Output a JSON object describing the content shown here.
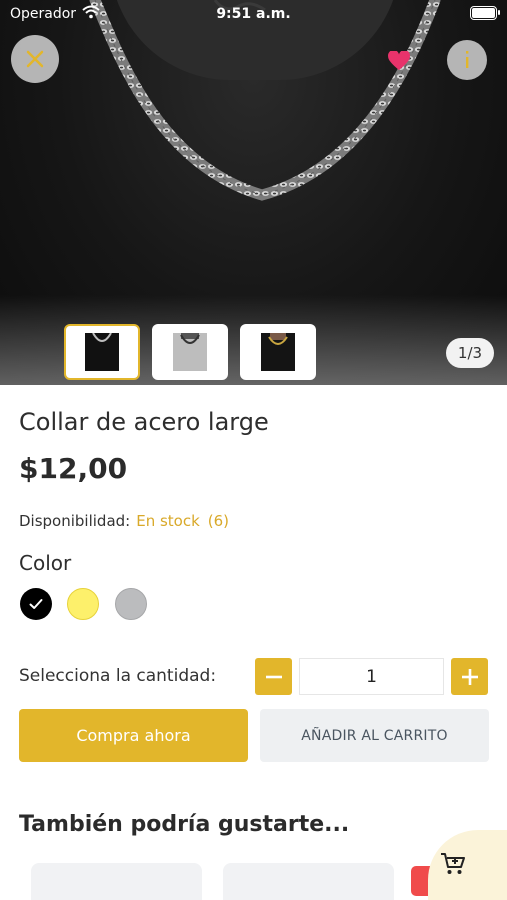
{
  "status_bar": {
    "carrier": "Operador",
    "time": "9:51 a.m."
  },
  "icons": {
    "close": "close-icon",
    "favorite": "heart-icon",
    "info": "info-icon",
    "cart": "cart-add-icon",
    "check": "check-icon"
  },
  "gallery": {
    "pager": "1/3",
    "thumbnails": [
      "black-tshirt-chain",
      "gray-tshirt-chain",
      "black-tshirt-gold-chain"
    ],
    "active_index": 0
  },
  "product": {
    "title": "Collar de acero large",
    "price": "$12,00",
    "availability_label": "Disponibilidad:",
    "availability_status": "En stock",
    "availability_count": "(6)",
    "color_label": "Color",
    "colors": [
      "#000000",
      "#fdf06b",
      "#bbbcbe"
    ],
    "selected_color": "#000000",
    "quantity_label": "Selecciona la cantidad:",
    "quantity": "1"
  },
  "actions": {
    "buy_now": "Compra ahora",
    "add_to_cart": "AÑADIR AL CARRITO"
  },
  "related": {
    "title": "También podría gustarte..."
  },
  "theme": {
    "accent": "#e2b62b",
    "favorite": "#e8336b",
    "sale": "#f04b4b"
  }
}
